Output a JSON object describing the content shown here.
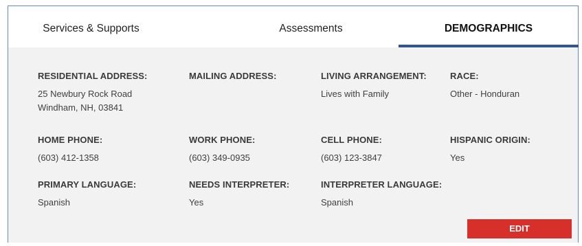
{
  "tabs": {
    "services": "Services & Supports",
    "assessments": "Assessments",
    "demographics": "DEMOGRAPHICS"
  },
  "demographics": {
    "residential_address": {
      "label": "RESIDENTIAL ADDRESS:",
      "value": "25 Newbury Rock Road\nWindham, NH, 03841"
    },
    "mailing_address": {
      "label": "MAILING ADDRESS:",
      "value": ""
    },
    "living_arrangement": {
      "label": "LIVING ARRANGEMENT:",
      "value": "Lives with Family"
    },
    "race": {
      "label": "RACE:",
      "value": "Other - Honduran"
    },
    "home_phone": {
      "label": "HOME PHONE:",
      "value": "(603) 412-1358"
    },
    "work_phone": {
      "label": "WORK PHONE:",
      "value": "(603) 349-0935"
    },
    "cell_phone": {
      "label": "CELL PHONE:",
      "value": "(603) 123-3847"
    },
    "hispanic_origin": {
      "label": "HISPANIC ORIGIN:",
      "value": "Yes"
    },
    "primary_language": {
      "label": "PRIMARY LANGUAGE:",
      "value": "Spanish"
    },
    "needs_interpreter": {
      "label": "NEEDS INTERPRETER:",
      "value": "Yes"
    },
    "interpreter_language": {
      "label": "INTERPRETER LANGUAGE:",
      "value": "Spanish"
    }
  },
  "actions": {
    "edit_label": "EDIT"
  },
  "colors": {
    "active_tab_underline": "#2e5597",
    "panel_background": "#f2f2f2",
    "edit_button": "#d7302a",
    "frame_border": "#5b8cc8"
  }
}
